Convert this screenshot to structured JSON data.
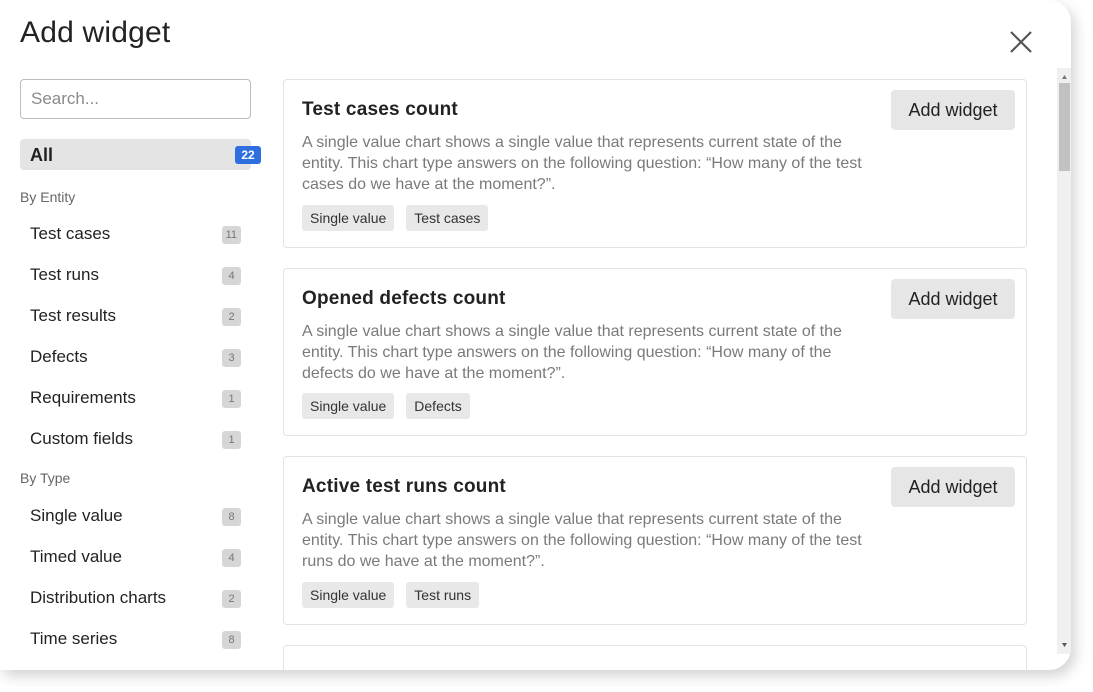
{
  "dialog": {
    "title": "Add widget",
    "close_icon": "close-icon"
  },
  "search": {
    "placeholder": "Search...",
    "value": ""
  },
  "nav_all": {
    "label": "All",
    "count": "22"
  },
  "by_entity": {
    "heading": "By Entity",
    "items": [
      {
        "label": "Test cases",
        "count": "11"
      },
      {
        "label": "Test runs",
        "count": "4"
      },
      {
        "label": "Test results",
        "count": "2"
      },
      {
        "label": "Defects",
        "count": "3"
      },
      {
        "label": "Requirements",
        "count": "1"
      },
      {
        "label": "Custom fields",
        "count": "1"
      }
    ]
  },
  "by_type": {
    "heading": "By Type",
    "items": [
      {
        "label": "Single value",
        "count": "8"
      },
      {
        "label": "Timed value",
        "count": "4"
      },
      {
        "label": "Distribution charts",
        "count": "2"
      },
      {
        "label": "Time series",
        "count": "8"
      }
    ]
  },
  "widgets": [
    {
      "title": "Test cases count",
      "description": "A single value chart shows a single value that represents current state of the entity. This chart type answers on the following question: “How many of the test cases do we have at the moment?”.",
      "button": "Add widget",
      "tags": [
        "Single value",
        "Test cases"
      ]
    },
    {
      "title": "Opened defects count",
      "description": "A single value chart shows a single value that represents current state of the entity. This chart type answers on the following question: “How many of the defects do we have at the moment?”.",
      "button": "Add widget",
      "tags": [
        "Single value",
        "Defects"
      ]
    },
    {
      "title": "Active test runs count",
      "description": "A single value chart shows a single value that represents current state of the entity. This chart type answers on the following question: “How many of the test runs do we have at the moment?”.",
      "button": "Add widget",
      "tags": [
        "Single value",
        "Test runs"
      ]
    }
  ],
  "colors": {
    "accent": "#2e6fe0",
    "badge": "#d6d6d6",
    "selected_bg": "#e4e4e4"
  }
}
